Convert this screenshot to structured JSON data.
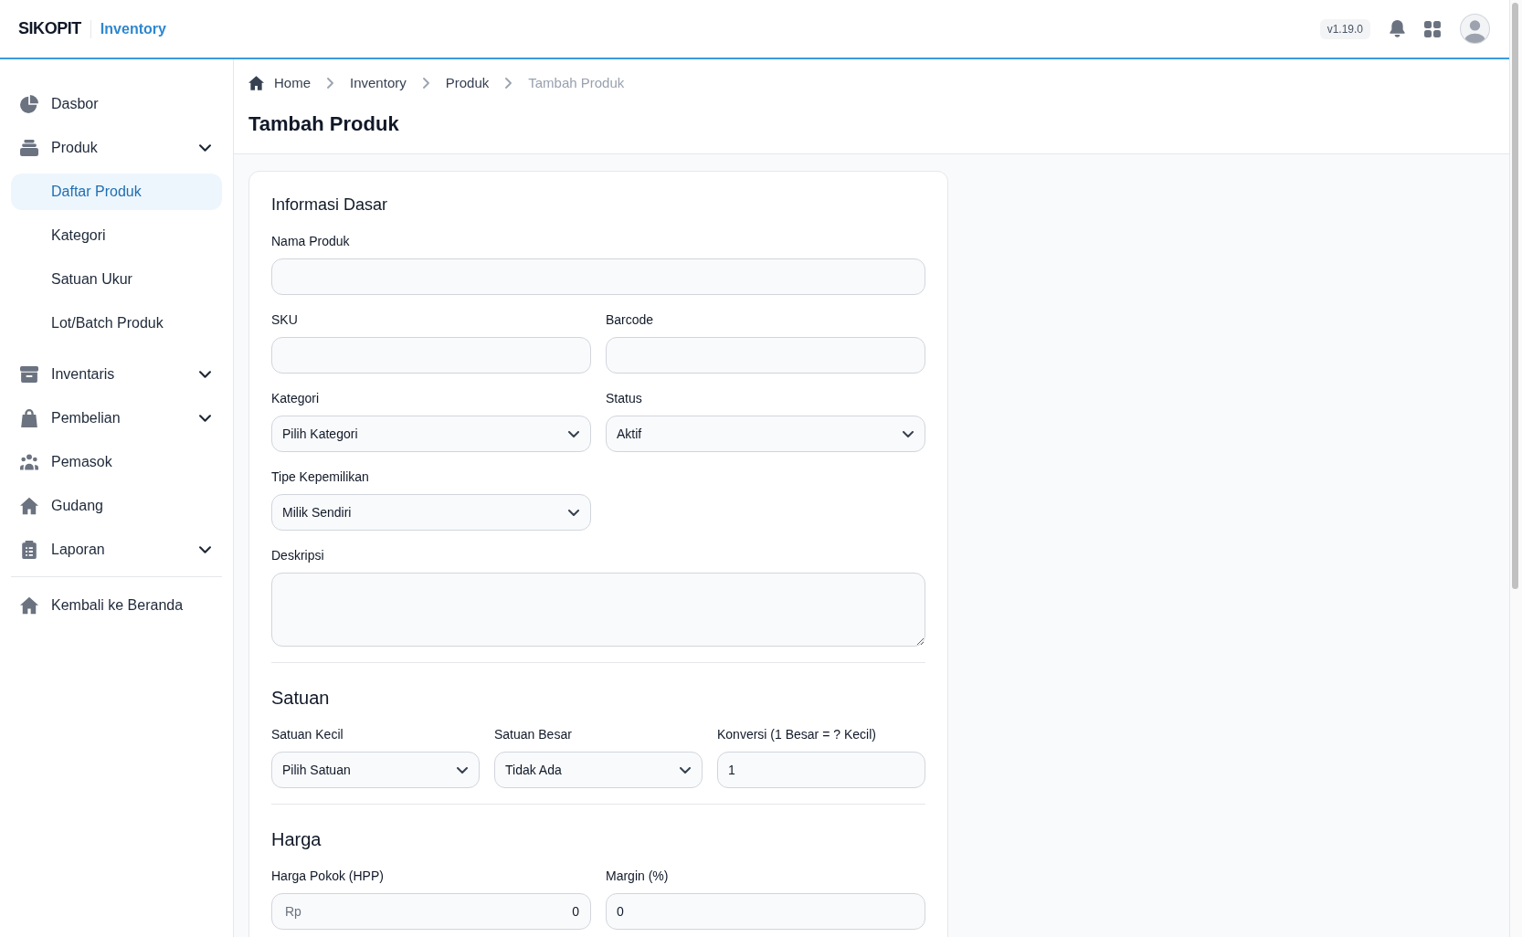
{
  "header": {
    "brand": "SIKOPIT",
    "module": "Inventory",
    "version": "v1.19.0"
  },
  "sidebar": {
    "items": [
      {
        "label": "Dasbor",
        "kind": "link",
        "selected": false
      },
      {
        "label": "Produk",
        "kind": "group",
        "selected": false,
        "children": [
          {
            "label": "Daftar Produk",
            "selected": true
          },
          {
            "label": "Kategori",
            "selected": false
          },
          {
            "label": "Satuan Ukur",
            "selected": false
          },
          {
            "label": "Lot/Batch Produk",
            "selected": false
          }
        ]
      },
      {
        "label": "Inventaris",
        "kind": "group",
        "selected": false
      },
      {
        "label": "Pembelian",
        "kind": "group",
        "selected": false
      },
      {
        "label": "Pemasok",
        "kind": "link",
        "selected": false
      },
      {
        "label": "Gudang",
        "kind": "link",
        "selected": false
      },
      {
        "label": "Laporan",
        "kind": "group",
        "selected": false
      }
    ],
    "footer_link": {
      "label": "Kembali ke Beranda"
    }
  },
  "breadcrumb": [
    {
      "label": "Home",
      "current": false
    },
    {
      "label": "Inventory",
      "current": false
    },
    {
      "label": "Produk",
      "current": false
    },
    {
      "label": "Tambah Produk",
      "current": true
    }
  ],
  "page_title": "Tambah Produk",
  "form": {
    "sections": [
      {
        "title": "Informasi Dasar",
        "rows": [
          [
            {
              "label": "Nama Produk",
              "kind": "text"
            }
          ],
          [
            {
              "label": "SKU",
              "kind": "text"
            },
            {
              "label": "Barcode",
              "kind": "text"
            }
          ],
          [
            {
              "label": "Kategori",
              "kind": "select",
              "value": "Pilih Kategori"
            },
            {
              "label": "Status",
              "kind": "select",
              "value": "Aktif"
            }
          ],
          [
            {
              "label": "Tipe Kepemilikan",
              "kind": "select",
              "value": "Milik Sendiri"
            }
          ],
          [
            {
              "label": "Deskripsi",
              "kind": "textarea"
            }
          ]
        ]
      },
      {
        "title": "Satuan",
        "rows": [
          [
            {
              "label": "Satuan Kecil",
              "kind": "select",
              "value": "Pilih Satuan"
            },
            {
              "label": "Satuan Besar",
              "kind": "select",
              "value": "Tidak Ada"
            },
            {
              "label": "Konversi (1 Besar = ? Kecil)",
              "kind": "text",
              "value": "1"
            }
          ]
        ]
      },
      {
        "title": "Harga",
        "rows": [
          [
            {
              "label": "Harga Pokok (HPP)",
              "kind": "currency",
              "prefix": "Rp",
              "value": "0"
            },
            {
              "label": "Margin (%)",
              "kind": "text",
              "value": "0"
            }
          ]
        ]
      }
    ]
  }
}
